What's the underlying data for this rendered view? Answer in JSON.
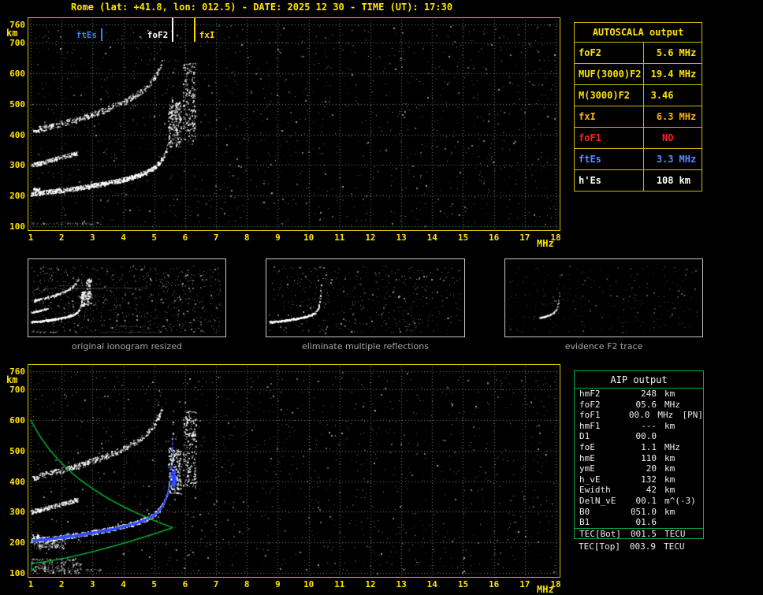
{
  "title": "Rome (lat: +41.8, lon: 012.5) - DATE: 2025 12 30 - TIME (UT): 17:30",
  "axes": {
    "x_ticks": [
      "1",
      "2",
      "3",
      "4",
      "5",
      "6",
      "7",
      "8",
      "9",
      "10",
      "11",
      "12",
      "13",
      "14",
      "15",
      "16",
      "17",
      "18"
    ],
    "x_unit": "MHz",
    "y_ticks": [
      "760",
      "700",
      "600",
      "500",
      "400",
      "300",
      "200",
      "100"
    ],
    "y_unit": "km"
  },
  "top_plot": {
    "markers": [
      {
        "label": "ftEs",
        "freq": 3.3,
        "color": "#3a7dff",
        "label_side": "left",
        "tall": false
      },
      {
        "label": "foF2",
        "freq": 5.6,
        "color": "#ffffff",
        "label_side": "left",
        "tall": true
      },
      {
        "label": "fxI",
        "freq": 6.3,
        "color": "#ffd800",
        "label_side": "right",
        "tall": true
      }
    ]
  },
  "autoscala": {
    "title": "AUTOSCALA output",
    "rows": [
      {
        "param": "foF2",
        "value": "5.6",
        "unit": "MHz",
        "color": "#ffe400"
      },
      {
        "param": "MUF(3000)F2",
        "value": "19.4",
        "unit": "MHz",
        "color": "#ffe400"
      },
      {
        "param": "M(3000)F2",
        "value": "3.46",
        "unit": "",
        "color": "#ffe400"
      },
      {
        "param": "fxI",
        "value": "6.3",
        "unit": "MHz",
        "color": "#ffb400"
      },
      {
        "param": "foF1",
        "value": "NO",
        "unit": "",
        "color": "#ff2020"
      },
      {
        "param": "ftEs",
        "value": "3.3",
        "unit": "MHz",
        "color": "#5b8cff"
      },
      {
        "param": "h'Es",
        "value": "108",
        "unit": "km",
        "color": "#ffffff"
      }
    ]
  },
  "thumbnails": [
    {
      "caption": "original ionogram resized"
    },
    {
      "caption": "eliminate multiple reflections"
    },
    {
      "caption": "evidence F2 trace"
    }
  ],
  "aip": {
    "title": "AIP output",
    "rows": [
      {
        "param": "hmF2",
        "value": "248",
        "unit": "km",
        "extra": ""
      },
      {
        "param": "foF2",
        "value": "05.6",
        "unit": "MHz",
        "extra": ""
      },
      {
        "param": "foF1",
        "value": "00.0",
        "unit": "MHz",
        "extra": "[PN]"
      },
      {
        "param": "hmF1",
        "value": "---",
        "unit": "km",
        "extra": ""
      },
      {
        "param": "D1",
        "value": "00.0",
        "unit": "",
        "extra": ""
      },
      {
        "param": "foE",
        "value": "1.1",
        "unit": "MHz",
        "extra": ""
      },
      {
        "param": "hmE",
        "value": "110",
        "unit": "km",
        "extra": ""
      },
      {
        "param": "ymE",
        "value": "20",
        "unit": "km",
        "extra": ""
      },
      {
        "param": "h_vE",
        "value": "132",
        "unit": "km",
        "extra": ""
      },
      {
        "param": "Ewidth",
        "value": "42",
        "unit": "km",
        "extra": ""
      },
      {
        "param": "DelN_vE",
        "value": "00.1",
        "unit": "m^(-3)",
        "extra": ""
      },
      {
        "param": "B0",
        "value": "051.0",
        "unit": "km",
        "extra": ""
      },
      {
        "param": "B1",
        "value": "01.6",
        "unit": "",
        "extra": ""
      },
      {
        "param": "TEC[Bot]",
        "value": "001.5",
        "unit": "TECU",
        "extra": ""
      }
    ],
    "outside_row": {
      "param": "TEC[Top]",
      "value": "003.9",
      "unit": "TECU",
      "extra": ""
    }
  },
  "plot_colors": {
    "grid": "#7d7d7d",
    "border": "#d6c400",
    "profile_green": "#00c838",
    "trace_blue": "#2e4bff"
  }
}
